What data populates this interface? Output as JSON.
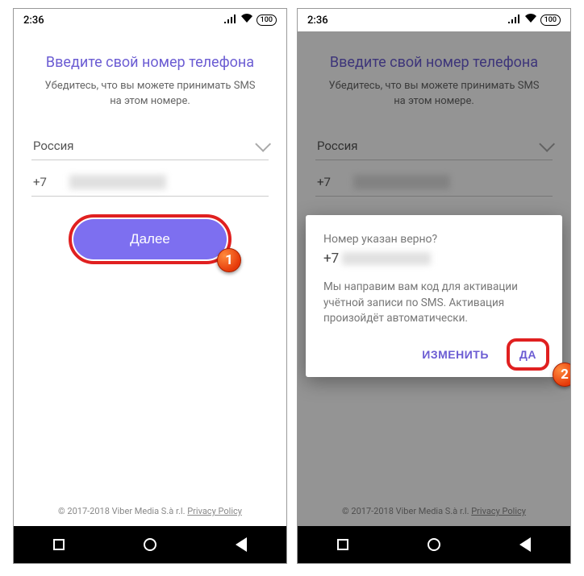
{
  "status": {
    "time": "2:36",
    "battery": "100"
  },
  "screen": {
    "title": "Введите свой номер телефона",
    "subtitle": "Убедитесь, что вы можете принимать SMS на этом номере.",
    "country": "Россия",
    "prefix": "+7",
    "next_label": "Далее"
  },
  "dialog": {
    "question": "Номер указан верно?",
    "number_prefix": "+7",
    "message": "Мы направим вам код для активации учётной записи по SMS. Активация произойдёт автоматически.",
    "edit_label": "ИЗМЕНИТЬ",
    "yes_label": "ДА"
  },
  "footer": {
    "copyright": "© 2017-2018 Viber Media S.à r.l.",
    "policy": "Privacy Policy"
  },
  "annotations": {
    "step1": "1",
    "step2": "2"
  }
}
